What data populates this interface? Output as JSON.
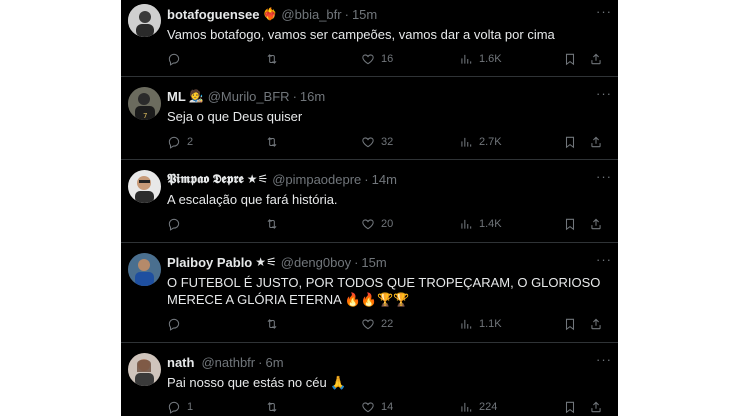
{
  "tweets": [
    {
      "name": "botafoguensee",
      "badge": "❤️‍🔥",
      "handle": "@bbia_bfr",
      "dot": "·",
      "time": "15m",
      "text": "Vamos botafogo, vamos ser campeões, vamos dar a volta por cima",
      "replies": "",
      "retweets": "",
      "likes": "16",
      "views": "1.6K"
    },
    {
      "name": "ML",
      "badge": "🧑‍🎨",
      "handle": "@Murilo_BFR",
      "dot": "·",
      "time": "16m",
      "text": "Seja o que Deus quiser",
      "replies": "2",
      "retweets": "",
      "likes": "32",
      "views": "2.7K"
    },
    {
      "name": "𝕻𝖎𝖒𝖕𝖆𝖔 𝕯𝖊𝖕𝖗𝖊",
      "badge": "★⚟",
      "handle": "@pimpaodepre",
      "dot": "·",
      "time": "14m",
      "text": "A escalação que fará história.",
      "replies": "",
      "retweets": "",
      "likes": "20",
      "views": "1.4K"
    },
    {
      "name": "Plaiboy Pablo",
      "badge": "★⚟",
      "handle": "@deng0boy",
      "dot": "·",
      "time": "15m",
      "text_line1": "O FUTEBOL É JUSTO, POR TODOS QUE TROPEÇARAM, O GLORIOSO",
      "text_line2": "MERECE A GLÓRIA ETERNA 🔥🔥🏆🏆",
      "replies": "",
      "retweets": "",
      "likes": "22",
      "views": "1.1K"
    },
    {
      "name": "nath",
      "badge": "",
      "handle": "@nathbfr",
      "dot": "·",
      "time": "6m",
      "text": "Pai nosso que estás no céu 🙏",
      "replies": "1",
      "retweets": "",
      "likes": "14",
      "views": "224"
    }
  ],
  "more_label": "···",
  "icons": {
    "reply": "reply-icon",
    "retweet": "retweet-icon",
    "like": "heart-icon",
    "views": "views-icon",
    "bookmark": "bookmark-icon",
    "share": "share-icon"
  },
  "colors": {
    "background": "#000000",
    "text": "#e7e9ea",
    "muted": "#71767b",
    "divider": "#2f3336"
  }
}
